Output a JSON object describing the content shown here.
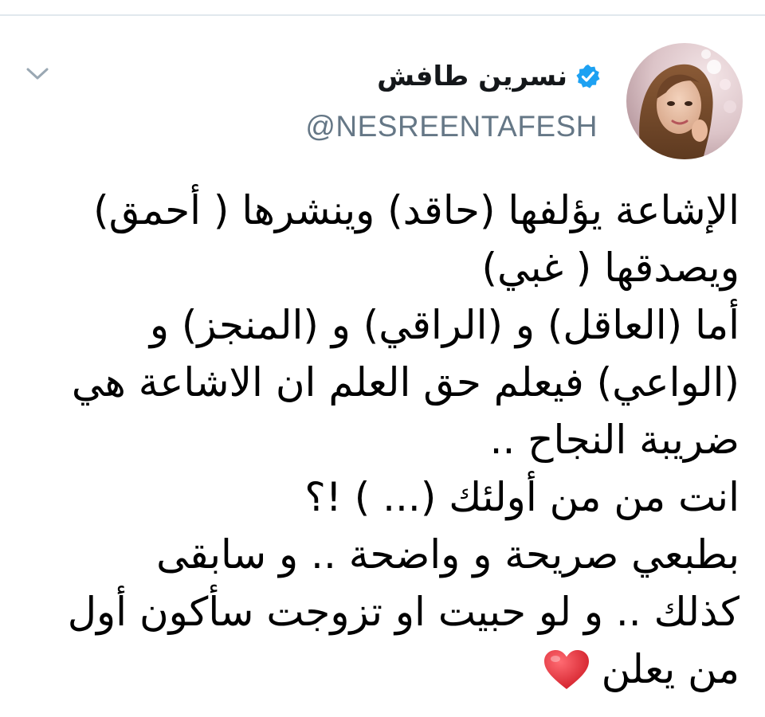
{
  "tweet": {
    "author": {
      "display_name": "نسرين طافش",
      "handle": "@NESREENTAFESH",
      "verified": true,
      "avatar_icon": "profile-photo"
    },
    "menu_icon": "chevron-down-icon",
    "body_lines": [
      "الإشاعة يؤلفها (حاقد) وينشرها ( أحمق)",
      "ويصدقها ( غبي)",
      "أما (العاقل) و (الراقي) و (المنجز) و",
      "(الواعي) فيعلم حق العلم ان الاشاعة هي",
      "ضريبة النجاح ..",
      "انت من من أولئك (... ) !؟",
      "بطبعي صريحة و واضحة .. و سابقى",
      "كذلك .. و لو حبيت او تزوجت سأكون أول",
      "من يعلن"
    ],
    "trailing_emoji": "red-heart"
  },
  "colors": {
    "verified_blue": "#1da1f2",
    "handle_gray": "#657786",
    "divider": "#e1e8ed",
    "heart_red": "#e0242f"
  }
}
